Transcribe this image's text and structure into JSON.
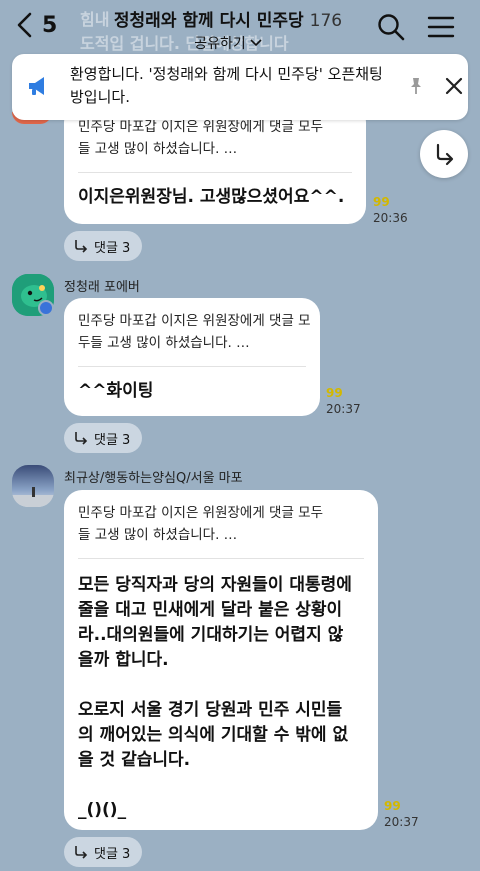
{
  "header": {
    "back_count": "5",
    "title": "정청래와 함께 다시 민주당",
    "member_count": "176",
    "share_label": "공유하기",
    "ghost_lines": [
      "힘내",
      "도적입 겁니다. 단결예상합니다"
    ]
  },
  "notice": {
    "text": "환영합니다. '정청래와 함께 다시 민주당' 오픈채팅방입니다."
  },
  "messages": [
    {
      "quote": "민주당 마포갑 이지은 위원장에게 댓글 모두들 고생 많이 하셨습니다. …",
      "text": "이지은위원장님. 고생많으셨어요^^.",
      "unread": "99",
      "time": "20:36",
      "replies": "댓글 3"
    },
    {
      "sender": "정청래 포에버",
      "quote": "민주당 마포갑 이지은 위원장에게 댓글 모두들 고생 많이 하셨습니다. …",
      "text": "^^화이팅",
      "unread": "99",
      "time": "20:37",
      "replies": "댓글 3"
    },
    {
      "sender": "최규상/행동하는양심Q/서울 마포",
      "quote": "민주당 마포갑 이지은 위원장에게 댓글 모두들 고생 많이 하셨습니다. …",
      "text": "모든 당직자과 당의 자원들이 대통령에\n줄을 대고 민새에게 달라 붙은 상황이\n라..대의원들에 기대하기는 어렵지 않\n을까 합니다.\n\n오로지 서울 경기 당원과 민주 시민들\n의 깨어있는 의식에 기대할 수 밖에 없\n을 것 같습니다.\n\n_()()_",
      "unread": "99",
      "time": "20:37",
      "replies": "댓글 3"
    }
  ],
  "colors": {
    "background": "#9bb0c3",
    "bubble": "#ffffff",
    "unread": "#d3b800",
    "notice_icon": "#2f7de1"
  },
  "icons": [
    "back-arrow-icon",
    "search-icon",
    "menu-icon",
    "megaphone-icon",
    "pin-icon",
    "close-icon",
    "reply-arrow-icon",
    "comment-arrow-icon",
    "crown-badge-icon"
  ]
}
